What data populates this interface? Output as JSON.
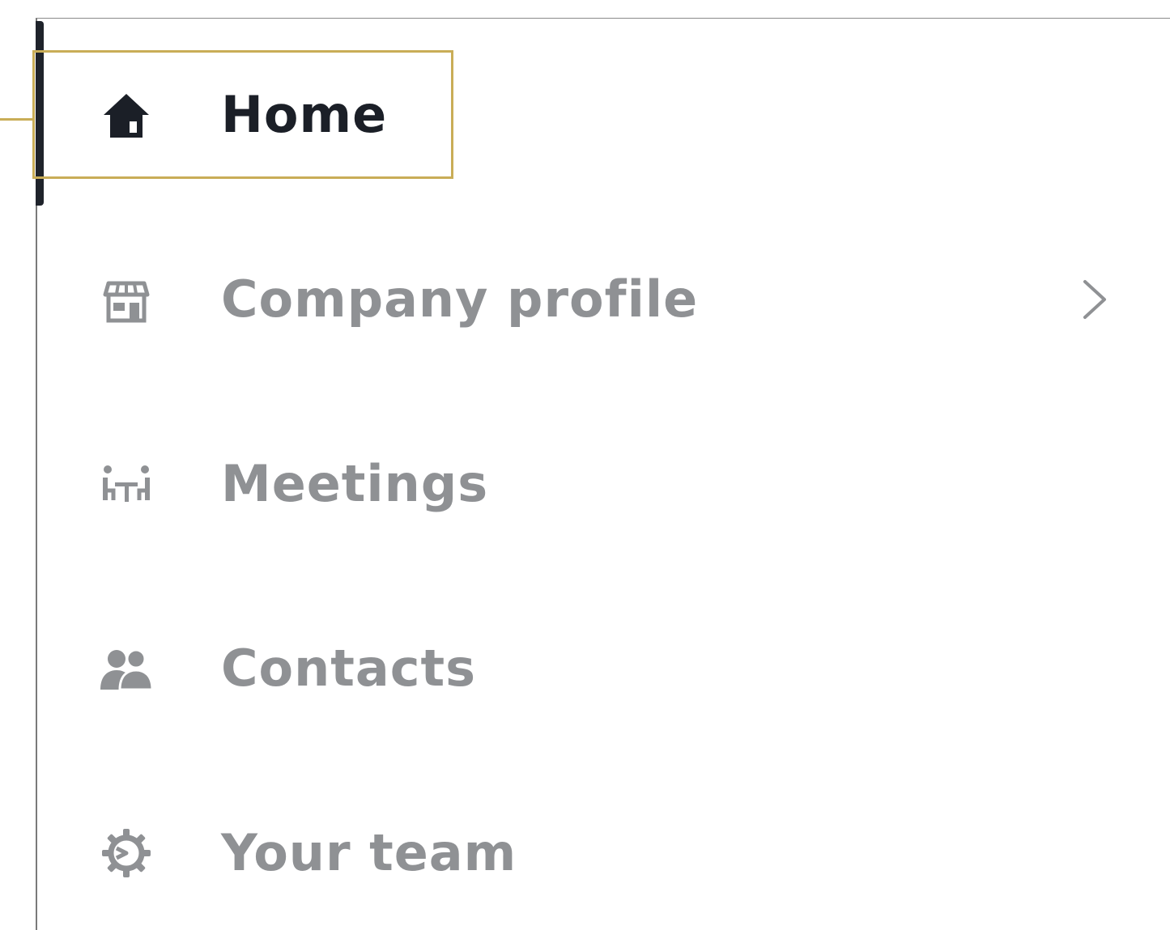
{
  "colors": {
    "active_text": "#1b1f27",
    "inactive_text": "#8f9194",
    "highlight": "#c9ad57",
    "active_indicator": "#1f232b"
  },
  "sidebar": {
    "items": [
      {
        "label": "Home",
        "icon": "home-icon",
        "active": true
      },
      {
        "label": "Company profile",
        "icon": "storefront-icon",
        "active": false,
        "has_submenu": true
      },
      {
        "label": "Meetings",
        "icon": "meeting-table-icon",
        "active": false
      },
      {
        "label": "Contacts",
        "icon": "contacts-icon",
        "active": false
      },
      {
        "label": "Your team",
        "icon": "gear-icon",
        "active": false
      }
    ]
  }
}
